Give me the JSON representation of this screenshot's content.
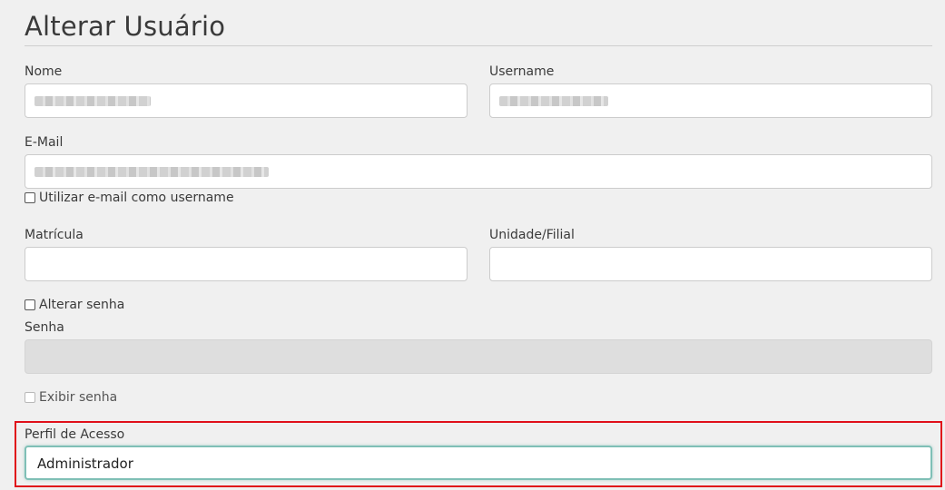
{
  "page": {
    "title": "Alterar Usuário"
  },
  "form": {
    "nome": {
      "label": "Nome",
      "value": ""
    },
    "username": {
      "label": "Username",
      "value": ""
    },
    "email": {
      "label": "E-Mail",
      "value": ""
    },
    "use_email_as_username": {
      "label": "Utilizar e-mail como username",
      "checked": false
    },
    "matricula": {
      "label": "Matrícula",
      "value": ""
    },
    "unidade": {
      "label": "Unidade/Filial",
      "value": ""
    },
    "alterar_senha": {
      "label": "Alterar senha",
      "checked": false
    },
    "senha": {
      "label": "Senha",
      "value": "",
      "disabled": true
    },
    "exibir_senha": {
      "label": "Exibir senha",
      "checked": false,
      "disabled": true
    },
    "perfil": {
      "label": "Perfil de Acesso",
      "selected": "Administrador"
    }
  },
  "colors": {
    "highlight": "#e0101a",
    "focus_border": "#7fbfb6"
  }
}
